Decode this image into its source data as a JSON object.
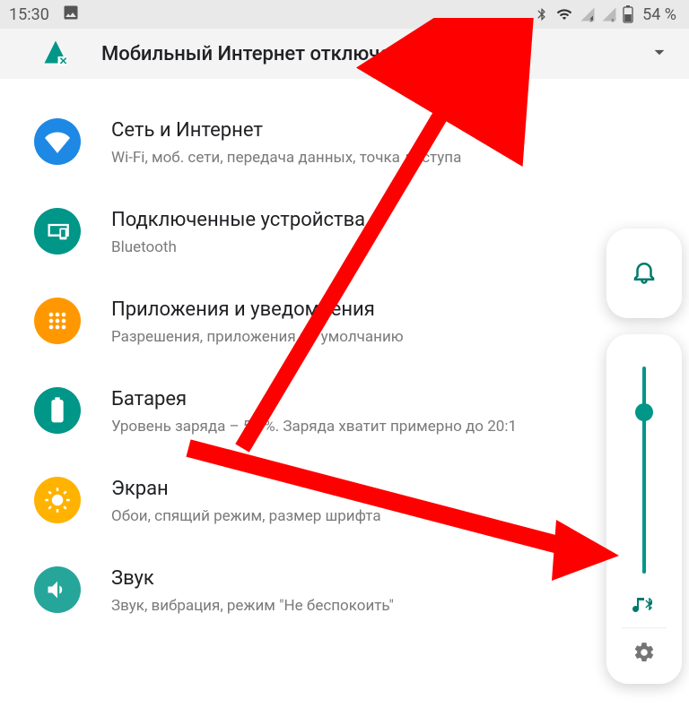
{
  "status": {
    "time": "15:30",
    "battery": "54 %"
  },
  "banner": {
    "title": "Мобильный Интернет отключен"
  },
  "items": [
    {
      "label": "Сеть и Интернет",
      "sub": "Wi-Fi, моб. сети, передача данных, точка доступа"
    },
    {
      "label": "Подключенные устройства",
      "sub": "Bluetooth"
    },
    {
      "label": "Приложения и уведомления",
      "sub": "Разрешения, приложения по умолчанию"
    },
    {
      "label": "Батарея",
      "sub": "Уровень заряда – 54 %. Заряда хватит примерно до 20:1"
    },
    {
      "label": "Экран",
      "sub": "Обои, спящий режим, размер шрифта"
    },
    {
      "label": "Звук",
      "sub": "Звук, вибрация, режим \"Не беспокоить\""
    }
  ]
}
